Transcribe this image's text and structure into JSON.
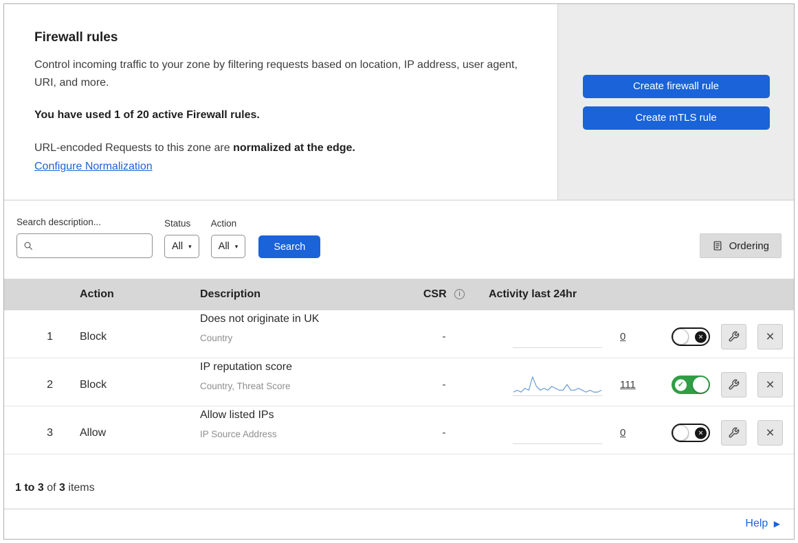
{
  "colors": {
    "accent_blue": "#1a63d8",
    "toggle_green": "#2f9e44",
    "sparkline": "#6fa1d9",
    "panel_gray": "#ececec",
    "table_header_gray": "#d7d7d7"
  },
  "icons": {
    "caret_down_glyph": "▾",
    "close_glyph": "×",
    "check_glyph": "✓",
    "info_glyph": "i",
    "help_arrow_glyph": "▶"
  },
  "header": {
    "title": "Firewall rules",
    "description": "Control incoming traffic to your zone by filtering requests based on location, IP address, user agent, URI, and more.",
    "usage_notice": "You have used 1 of 20 active Firewall rules.",
    "normalization_text": "URL-encoded Requests to this zone are",
    "normalization_bold": "normalized at the edge.",
    "normalization_link": "Configure Normalization",
    "buttons": {
      "create_firewall": "Create firewall rule",
      "create_mtls": "Create mTLS rule"
    }
  },
  "filters": {
    "search_label": "Search description...",
    "status_label": "Status",
    "status_value": "All",
    "action_label": "Action",
    "action_value": "All",
    "search_button": "Search",
    "ordering_button": "Ordering"
  },
  "table": {
    "headers": {
      "action": "Action",
      "description": "Description",
      "csr": "CSR",
      "activity": "Activity last 24hr"
    },
    "rows": [
      {
        "index": "1",
        "action": "Block",
        "description": "Does not originate in UK",
        "criteria": "Country",
        "csr": "-",
        "activity": "0",
        "enabled": false,
        "sparkline": []
      },
      {
        "index": "2",
        "action": "Block",
        "description": "IP reputation score",
        "criteria": "Country, Threat Score",
        "csr": "-",
        "activity": "111",
        "enabled": true,
        "sparkline": [
          1,
          2,
          1,
          3,
          2,
          9,
          4,
          2,
          3,
          2,
          4,
          3,
          2,
          2,
          5,
          2,
          2,
          3,
          2,
          1,
          2,
          1,
          1,
          2
        ]
      },
      {
        "index": "3",
        "action": "Allow",
        "description": "Allow listed IPs",
        "criteria": "IP Source Address",
        "csr": "-",
        "activity": "0",
        "enabled": false,
        "sparkline": []
      }
    ]
  },
  "footer": {
    "range": "1 to 3",
    "of": "of",
    "total": "3",
    "items": "items"
  },
  "help": {
    "label": "Help"
  }
}
